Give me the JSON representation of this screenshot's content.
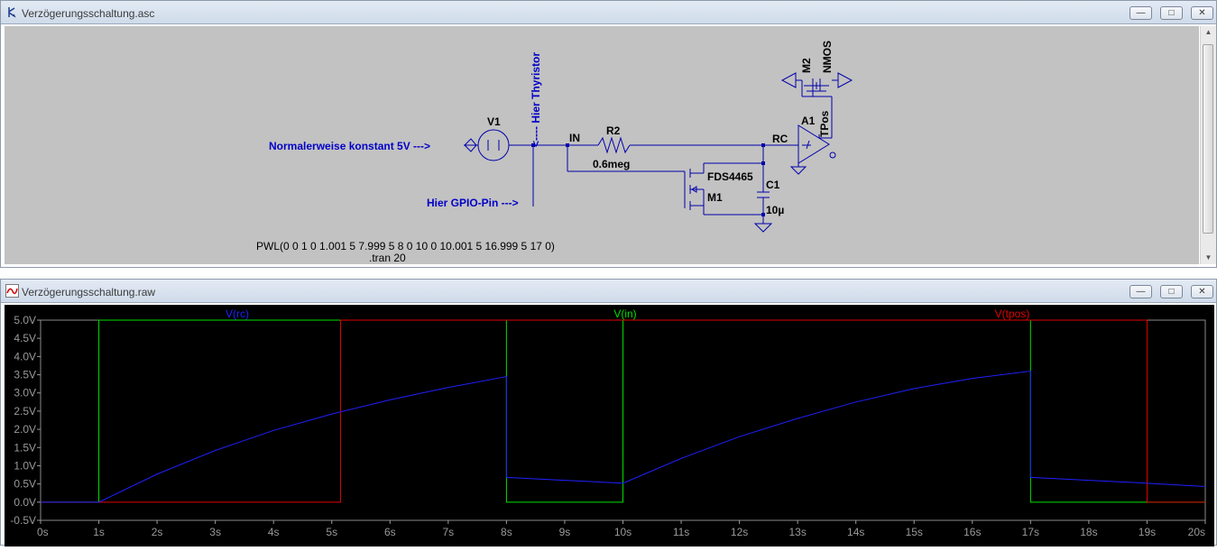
{
  "schematic_window": {
    "title": "Verzögerungsschaltung.asc",
    "buttons": [
      "—",
      "□",
      "✕"
    ],
    "labels": {
      "v1": "V1",
      "normal": "Normalerweise konstant 5V --->",
      "gpio": "Hier GPIO-Pin --->",
      "thyristor": "<---- Hier Thyristor",
      "in": "IN",
      "r2": "R2",
      "r2_val": "0.6meg",
      "rc": "RC",
      "m1_model": "FDS4465",
      "m1": "M1",
      "c1": "C1",
      "c1_val": "10µ",
      "a1": "A1",
      "tpos": "TPos",
      "m2": "M2",
      "nmos": "NMOS",
      "pwl": "PWL(0 0 1 0 1.001 5 7.999 5 8 0 10 0 10.001 5 16.999 5 17 0)",
      "tran": ".tran 20"
    }
  },
  "plot_window": {
    "title": "Verzögerungsschaltung.raw",
    "buttons": [
      "—",
      "□",
      "✕"
    ]
  },
  "chart_data": {
    "type": "line",
    "xlabel": "",
    "ylabel": "",
    "xlim": [
      0,
      20
    ],
    "ylim": [
      -0.5,
      5.0
    ],
    "x_ticks": [
      "0s",
      "1s",
      "2s",
      "3s",
      "4s",
      "5s",
      "6s",
      "7s",
      "8s",
      "9s",
      "10s",
      "11s",
      "12s",
      "13s",
      "14s",
      "15s",
      "16s",
      "17s",
      "18s",
      "19s",
      "20s"
    ],
    "y_ticks": [
      "5.0V",
      "4.5V",
      "4.0V",
      "3.5V",
      "3.0V",
      "2.5V",
      "2.0V",
      "1.5V",
      "1.0V",
      "0.5V",
      "0.0V",
      "-0.5V"
    ],
    "background": "#000000",
    "series": [
      {
        "name": "V(rc)",
        "color": "#2020ff",
        "x": [
          0,
          1,
          2,
          3,
          4,
          5,
          6,
          7,
          8,
          8.0,
          9,
          10,
          11,
          12,
          13,
          14,
          15,
          16,
          17,
          17.0,
          18,
          19,
          20
        ],
        "y": [
          0,
          0,
          0.77,
          1.42,
          1.97,
          2.42,
          2.81,
          3.15,
          3.45,
          0.68,
          0.6,
          0.52,
          1.2,
          1.8,
          2.3,
          2.75,
          3.12,
          3.4,
          3.6,
          0.68,
          0.6,
          0.52,
          0.43
        ]
      },
      {
        "name": "V(in)",
        "color": "#00e000",
        "x": [
          0,
          1,
          1.001,
          7.999,
          8,
          10,
          10.001,
          16.999,
          17,
          20
        ],
        "y": [
          0,
          0,
          5,
          5,
          0,
          0,
          5,
          5,
          0,
          0
        ]
      },
      {
        "name": "V(tpos)",
        "color": "#e00000",
        "x": [
          0,
          5.15,
          5.151,
          19.0,
          19.001,
          20
        ],
        "y": [
          0,
          0,
          5,
          5,
          0,
          0
        ]
      }
    ]
  }
}
